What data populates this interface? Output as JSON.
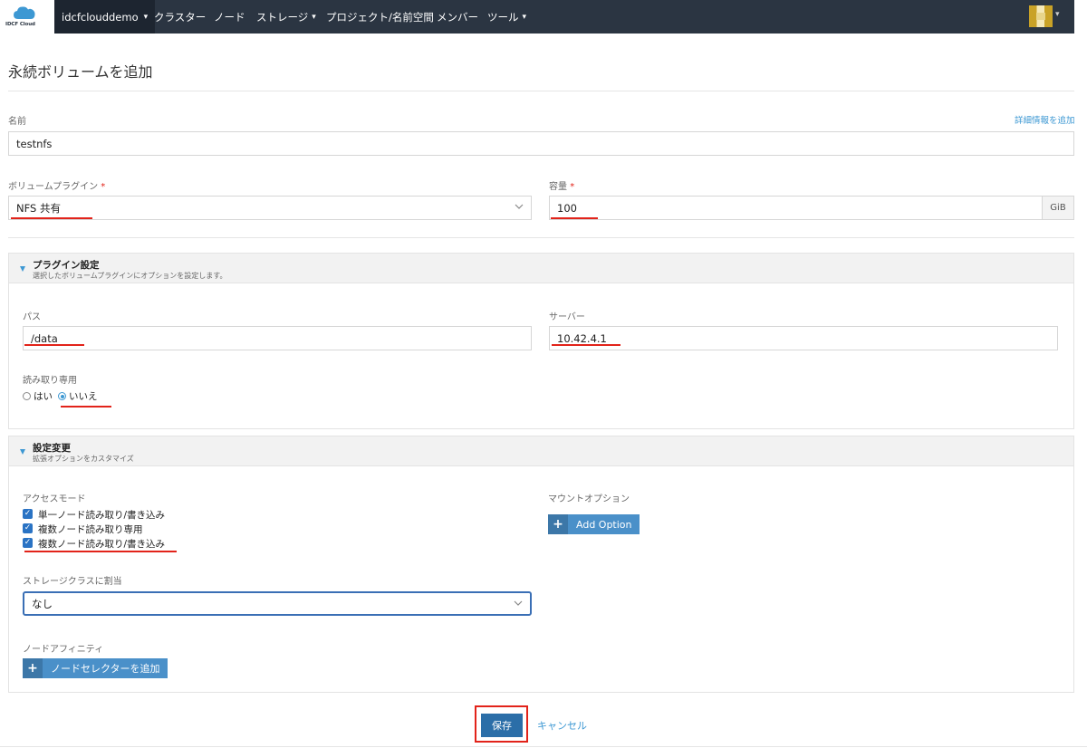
{
  "brand": {
    "logo_text": "IDCF Cloud"
  },
  "nav": {
    "cluster": "idcfclouddemo",
    "items": [
      "クラスター",
      "ノード",
      "ストレージ",
      "プロジェクト/名前空間",
      "メンバー",
      "ツール"
    ]
  },
  "page": {
    "title": "永続ボリュームを追加",
    "add_detail_link": "詳細情報を追加"
  },
  "form": {
    "name_label": "名前",
    "name_value": "testnfs",
    "plugin_label": "ボリュームプラグイン",
    "plugin_value": "NFS 共有",
    "capacity_label": "容量",
    "capacity_value": "100",
    "capacity_unit": "GiB",
    "required_mark": "*"
  },
  "plugin_section": {
    "title": "プラグイン設定",
    "description": "選択したボリュームプラグインにオプションを設定します。",
    "path_label": "パス",
    "path_value": "/data",
    "server_label": "サーバー",
    "server_value": "10.42.4.1",
    "readonly_label": "読み取り専用",
    "readonly_yes": "はい",
    "readonly_no": "いいえ",
    "readonly_selected": "いいえ"
  },
  "custom_section": {
    "title": "設定変更",
    "description": "拡張オプションをカスタマイズ",
    "access_mode_label": "アクセスモード",
    "access_modes": [
      {
        "label": "単一ノード読み取り/書き込み",
        "checked": true
      },
      {
        "label": "複数ノード読み取り専用",
        "checked": true
      },
      {
        "label": "複数ノード読み取り/書き込み",
        "checked": true
      }
    ],
    "mount_options_label": "マウントオプション",
    "add_option_button": "Add Option",
    "storage_class_label": "ストレージクラスに割当",
    "storage_class_value": "なし",
    "node_affinity_label": "ノードアフィニティ",
    "add_node_selector_button": "ノードセレクターを追加"
  },
  "actions": {
    "save": "保存",
    "cancel": "キャンセル"
  },
  "colors": {
    "topbar": "#2b3542",
    "accent": "#3d98d3",
    "annotation_red": "#e2231a",
    "save_button": "#2b6ea8"
  }
}
